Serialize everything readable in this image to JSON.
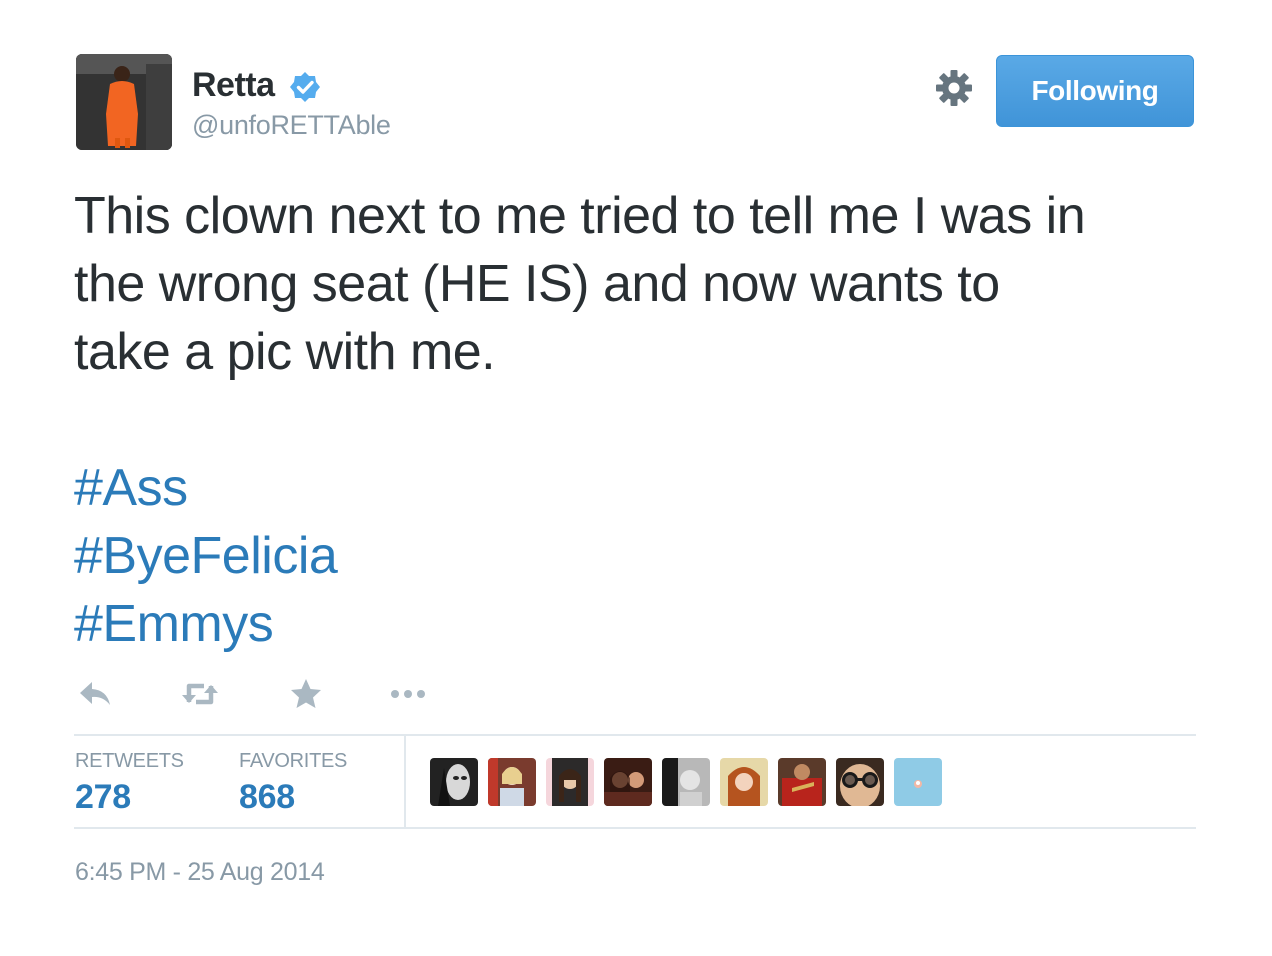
{
  "author": {
    "display_name": "Retta",
    "handle": "@unfoRETTAble",
    "verified": true
  },
  "follow_button": {
    "label": "Following"
  },
  "tweet": {
    "lines": [
      "This clown next to me tried to tell me I was in",
      "the wrong seat (HE IS) and now wants to",
      "take a pic with me."
    ],
    "hashtags": [
      "#Ass",
      "#ByeFelicia",
      "#Emmys"
    ]
  },
  "actions": [
    {
      "name": "reply-icon"
    },
    {
      "name": "retweet-icon"
    },
    {
      "name": "favorite-star-icon"
    },
    {
      "name": "more-options-icon"
    }
  ],
  "stats": {
    "retweets_label": "RETWEETS",
    "retweets_count": "278",
    "favorites_label": "FAVORITES",
    "favorites_count": "868"
  },
  "favoriters_count_shown": 9,
  "timestamp": "6:45 PM - 25 Aug 2014",
  "colors": {
    "text": "#292f33",
    "muted": "#8899a6",
    "link": "#2b7bb9",
    "button": "#4a9de0",
    "verified_badge": "#55acee",
    "divider": "#e1e8ed",
    "icon": "#aab8c2"
  }
}
